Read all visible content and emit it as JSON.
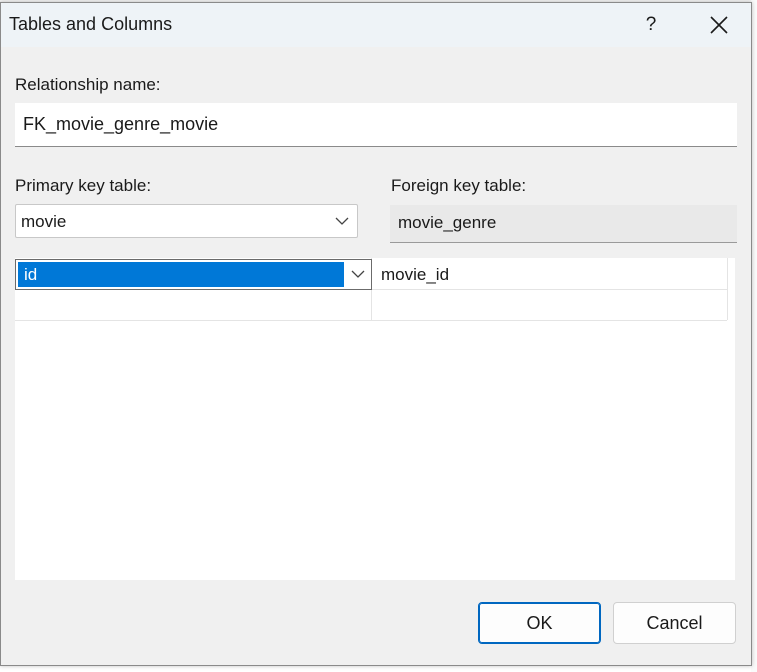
{
  "dialog": {
    "title": "Tables and Columns",
    "help_label": "?",
    "close_icon": "close-icon"
  },
  "relationship": {
    "label": "Relationship name:",
    "value": "FK_movie_genre_movie"
  },
  "primary_key": {
    "label": "Primary key table:",
    "selected": "movie"
  },
  "foreign_key": {
    "label": "Foreign key table:",
    "value": "movie_genre"
  },
  "columns": {
    "rows": [
      {
        "primary": "id",
        "foreign": "movie_id"
      },
      {
        "primary": "",
        "foreign": ""
      }
    ]
  },
  "buttons": {
    "ok": "OK",
    "cancel": "Cancel"
  },
  "colors": {
    "selection": "#0078d7",
    "default_button_border": "#0067c0"
  }
}
